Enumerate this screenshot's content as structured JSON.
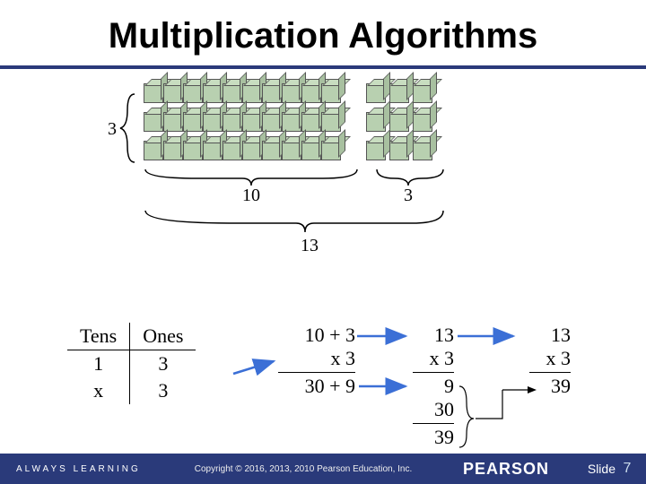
{
  "title": "Multiplication Algorithms",
  "footer": {
    "tagline": "ALWAYS LEARNING",
    "copyright": "Copyright © 2016, 2013, 2010 Pearson Education, Inc.",
    "brand": "PEARSON",
    "slide_label": "Slide",
    "page_number": "7"
  },
  "diagram": {
    "rows_label": "3",
    "tens_label": "10",
    "ones_label": "3",
    "total_label": "13",
    "tens_per_row": 10,
    "ones_per_row": 3,
    "num_rows": 3
  },
  "place_value": {
    "headers": {
      "tens": "Tens",
      "ones": "Ones"
    },
    "row1": {
      "tens": "1",
      "ones": "3"
    },
    "row2": {
      "tens": "x",
      "ones": "3"
    }
  },
  "mult_expanded": {
    "line1": "10 + 3",
    "line2": "x 3",
    "line3": "30 + 9"
  },
  "mult_partial": {
    "line1": "13",
    "line2": "x 3",
    "line3": "9",
    "line4": "30",
    "line5": "39"
  },
  "mult_standard": {
    "line1": "13",
    "line2": "x 3",
    "line3": "39"
  },
  "colors": {
    "accent": "#2a3a7a",
    "arrow": "#3b6fd6"
  }
}
